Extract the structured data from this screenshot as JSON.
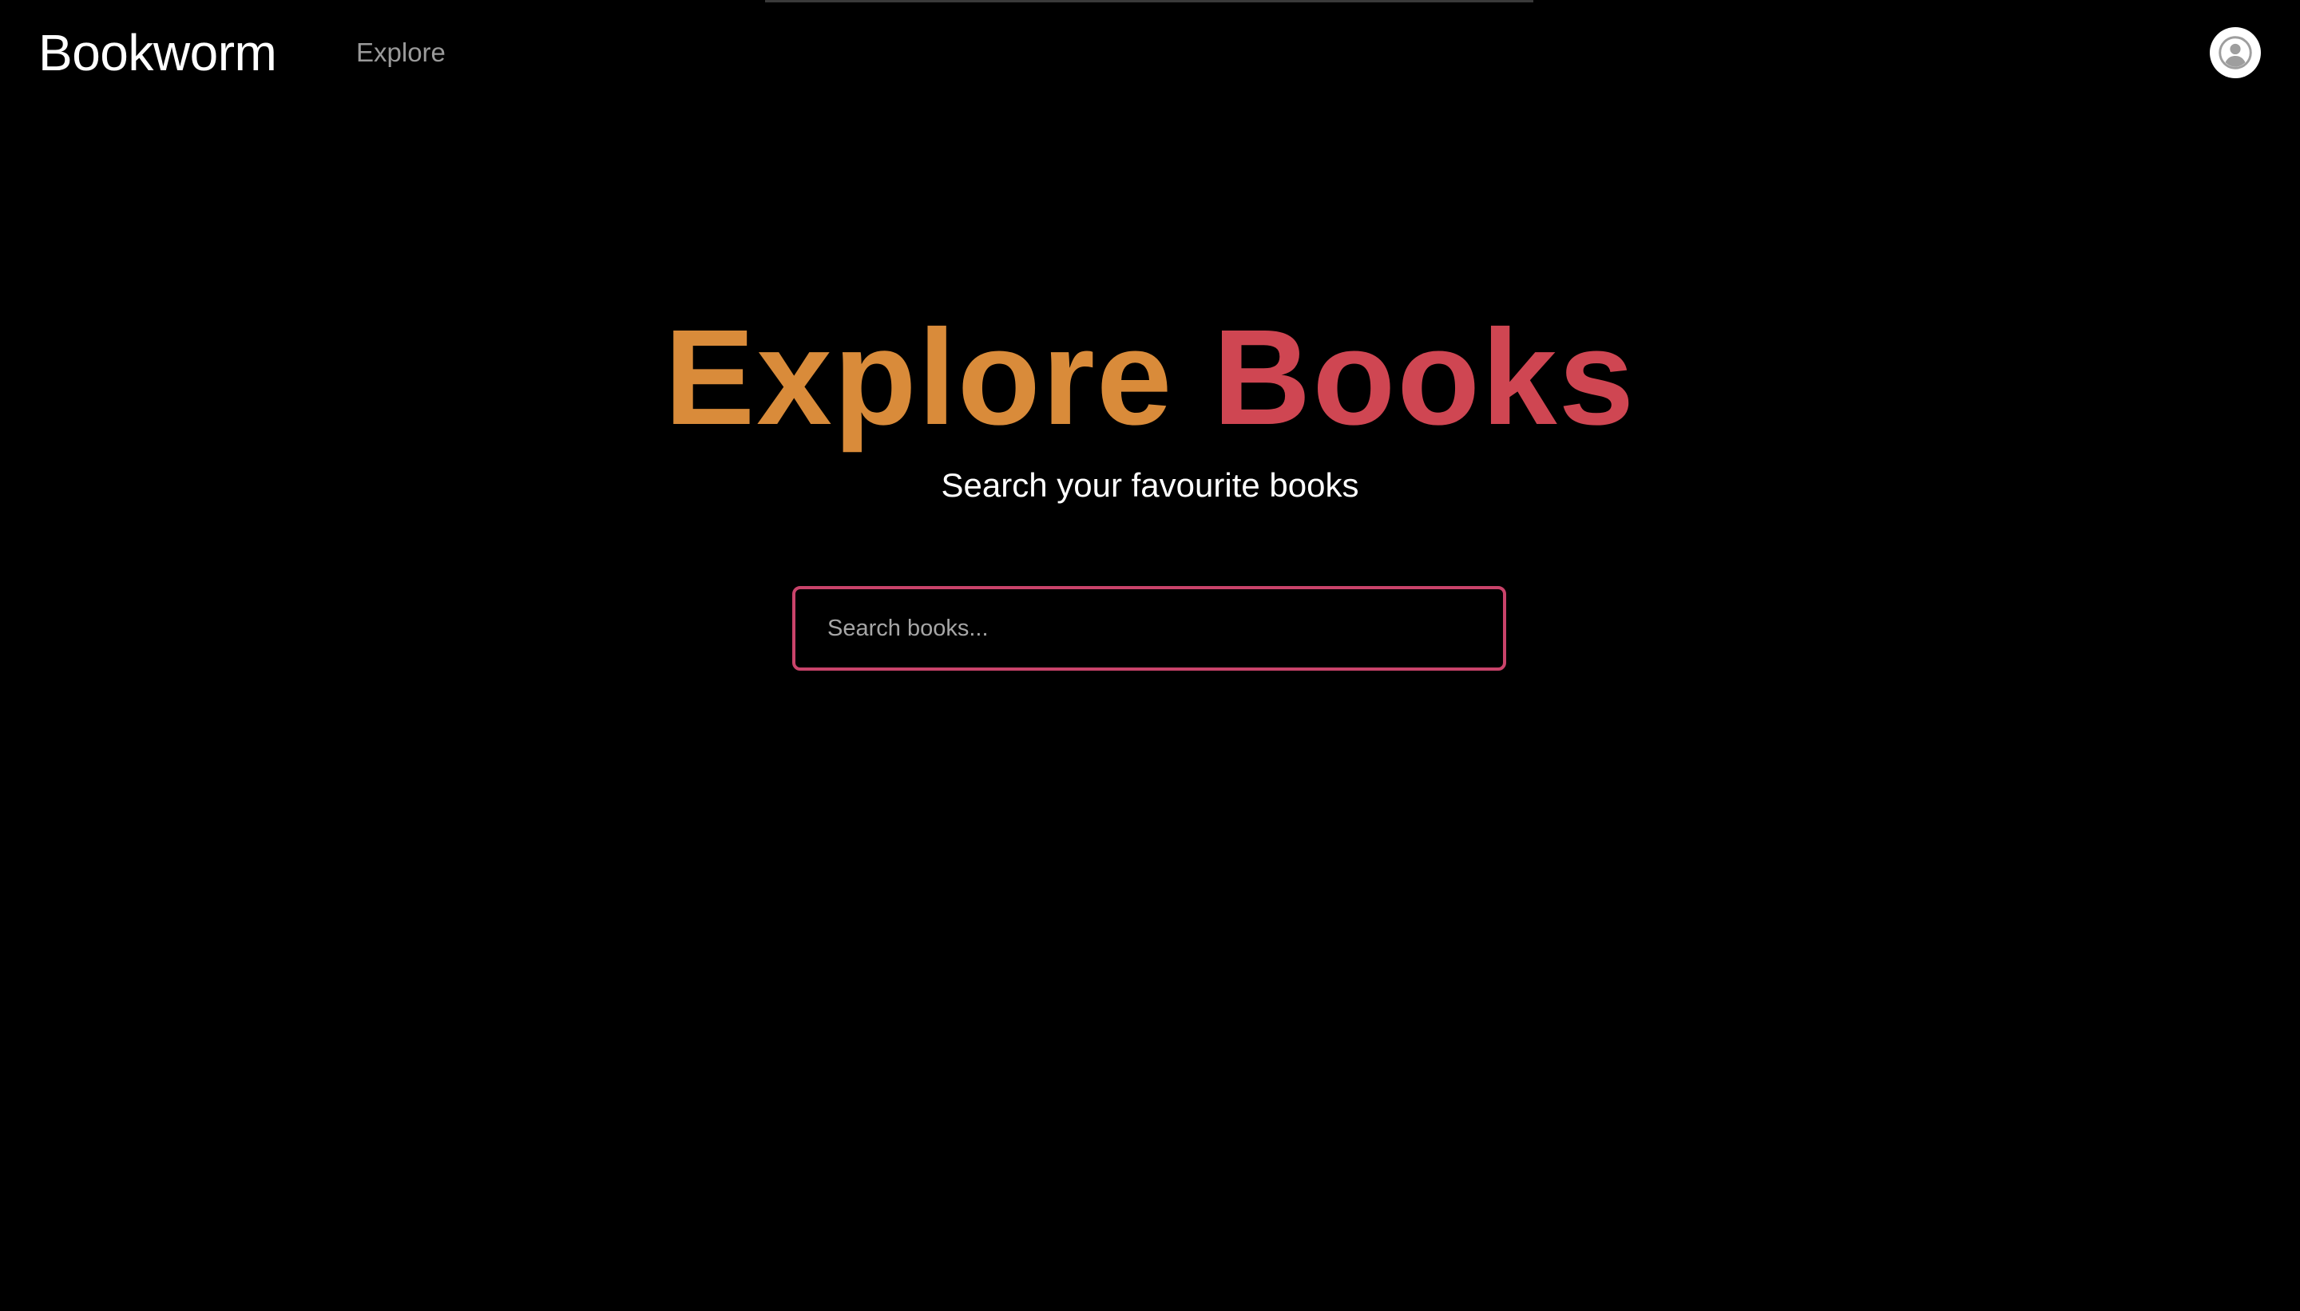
{
  "navbar": {
    "brand": "Bookworm",
    "links": [
      {
        "label": "Explore"
      }
    ],
    "avatar_icon": "user-avatar-icon"
  },
  "hero": {
    "title_part1": "Explore",
    "title_part2": "Books",
    "subtitle": "Search your favourite books"
  },
  "search": {
    "placeholder": "Search books...",
    "value": ""
  },
  "colors": {
    "background": "#000000",
    "title_part1": "#d98b3a",
    "title_part2": "#cf4652",
    "search_border": "#c9436a",
    "nav_link": "#9a9a9a"
  }
}
